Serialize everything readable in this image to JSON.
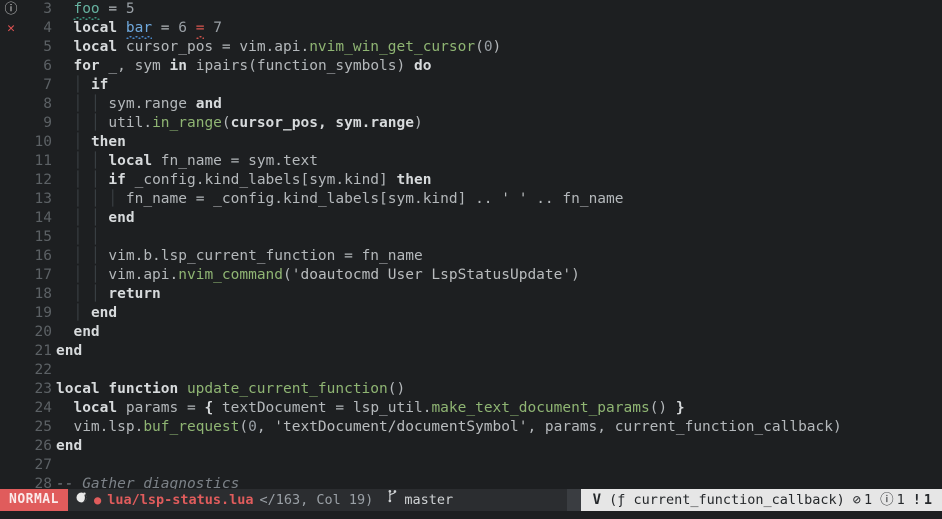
{
  "editor": {
    "lines": [
      {
        "num": "3",
        "sign": "info-icon",
        "tokens": [
          {
            "t": "  ",
            "c": "plain"
          },
          {
            "t": "foo",
            "c": "teal",
            "squiggle": "teal"
          },
          {
            "t": " ",
            "c": "plain"
          },
          {
            "t": "=",
            "c": "op"
          },
          {
            "t": " ",
            "c": "plain"
          },
          {
            "t": "5",
            "c": "num"
          }
        ]
      },
      {
        "num": "4",
        "sign": "error-icon",
        "tokens": [
          {
            "t": "  ",
            "c": "plain"
          },
          {
            "t": "local",
            "c": "kw"
          },
          {
            "t": " ",
            "c": "plain"
          },
          {
            "t": "bar",
            "c": "blue",
            "squiggle": "blue"
          },
          {
            "t": " ",
            "c": "plain"
          },
          {
            "t": "=",
            "c": "op"
          },
          {
            "t": " ",
            "c": "plain"
          },
          {
            "t": "6",
            "c": "num"
          },
          {
            "t": " ",
            "c": "plain"
          },
          {
            "t": "=",
            "c": "red",
            "squiggle": "red"
          },
          {
            "t": " ",
            "c": "plain"
          },
          {
            "t": "7",
            "c": "num"
          }
        ]
      },
      {
        "num": "5",
        "sign": "",
        "tokens": [
          {
            "t": "  ",
            "c": "plain"
          },
          {
            "t": "local",
            "c": "kw"
          },
          {
            "t": " cursor_pos ",
            "c": "ident"
          },
          {
            "t": "=",
            "c": "op"
          },
          {
            "t": " vim.api.",
            "c": "ident"
          },
          {
            "t": "nvim_win_get_cursor",
            "c": "fn"
          },
          {
            "t": "(",
            "c": "op"
          },
          {
            "t": "0",
            "c": "num"
          },
          {
            "t": ")",
            "c": "op"
          }
        ]
      },
      {
        "num": "6",
        "sign": "",
        "tokens": [
          {
            "t": "  ",
            "c": "plain"
          },
          {
            "t": "for",
            "c": "kw"
          },
          {
            "t": " _, sym ",
            "c": "ident"
          },
          {
            "t": "in",
            "c": "kw"
          },
          {
            "t": " ",
            "c": "plain"
          },
          {
            "t": "ipairs",
            "c": "ident"
          },
          {
            "t": "(function_symbols) ",
            "c": "ident"
          },
          {
            "t": "do",
            "c": "kw"
          }
        ]
      },
      {
        "num": "7",
        "sign": "",
        "tokens": [
          {
            "t": "  ",
            "c": "plain"
          },
          {
            "t": "│ ",
            "c": "ig"
          },
          {
            "t": "if",
            "c": "kw"
          }
        ]
      },
      {
        "num": "8",
        "sign": "",
        "tokens": [
          {
            "t": "  ",
            "c": "plain"
          },
          {
            "t": "│ ",
            "c": "ig"
          },
          {
            "t": "│ ",
            "c": "ig"
          },
          {
            "t": "sym.range ",
            "c": "ident"
          },
          {
            "t": "and",
            "c": "kw"
          }
        ]
      },
      {
        "num": "9",
        "sign": "",
        "tokens": [
          {
            "t": "  ",
            "c": "plain"
          },
          {
            "t": "│ ",
            "c": "ig"
          },
          {
            "t": "│ ",
            "c": "ig"
          },
          {
            "t": "util.",
            "c": "ident"
          },
          {
            "t": "in_range",
            "c": "fn"
          },
          {
            "t": "(",
            "c": "op"
          },
          {
            "t": "cursor_pos, sym.range",
            "c": "kw"
          },
          {
            "t": ")",
            "c": "op"
          }
        ]
      },
      {
        "num": "10",
        "sign": "",
        "tokens": [
          {
            "t": "  ",
            "c": "plain"
          },
          {
            "t": "│ ",
            "c": "ig"
          },
          {
            "t": "then",
            "c": "kw"
          }
        ]
      },
      {
        "num": "11",
        "sign": "",
        "tokens": [
          {
            "t": "  ",
            "c": "plain"
          },
          {
            "t": "│ ",
            "c": "ig"
          },
          {
            "t": "│ ",
            "c": "ig"
          },
          {
            "t": "local",
            "c": "kw"
          },
          {
            "t": " fn_name ",
            "c": "ident"
          },
          {
            "t": "=",
            "c": "op"
          },
          {
            "t": " sym.text",
            "c": "ident"
          }
        ]
      },
      {
        "num": "12",
        "sign": "",
        "tokens": [
          {
            "t": "  ",
            "c": "plain"
          },
          {
            "t": "│ ",
            "c": "ig"
          },
          {
            "t": "│ ",
            "c": "ig"
          },
          {
            "t": "if",
            "c": "kw"
          },
          {
            "t": " _config.kind_labels[sym.kind] ",
            "c": "ident"
          },
          {
            "t": "then",
            "c": "kw"
          }
        ]
      },
      {
        "num": "13",
        "sign": "",
        "tokens": [
          {
            "t": "  ",
            "c": "plain"
          },
          {
            "t": "│ ",
            "c": "ig"
          },
          {
            "t": "│ ",
            "c": "ig"
          },
          {
            "t": "│ ",
            "c": "ig"
          },
          {
            "t": "fn_name ",
            "c": "ident"
          },
          {
            "t": "=",
            "c": "op"
          },
          {
            "t": " _config.kind_labels[sym.kind] .. ",
            "c": "ident"
          },
          {
            "t": "' '",
            "c": "str"
          },
          {
            "t": " .. fn_name",
            "c": "ident"
          }
        ]
      },
      {
        "num": "14",
        "sign": "",
        "tokens": [
          {
            "t": "  ",
            "c": "plain"
          },
          {
            "t": "│ ",
            "c": "ig"
          },
          {
            "t": "│ ",
            "c": "ig"
          },
          {
            "t": "end",
            "c": "kw"
          }
        ]
      },
      {
        "num": "15",
        "sign": "",
        "tokens": [
          {
            "t": "  ",
            "c": "plain"
          },
          {
            "t": "│ ",
            "c": "ig"
          },
          {
            "t": "│",
            "c": "ig"
          }
        ]
      },
      {
        "num": "16",
        "sign": "",
        "tokens": [
          {
            "t": "  ",
            "c": "plain"
          },
          {
            "t": "│ ",
            "c": "ig"
          },
          {
            "t": "│ ",
            "c": "ig"
          },
          {
            "t": "vim.b.lsp_current_function ",
            "c": "ident"
          },
          {
            "t": "=",
            "c": "op"
          },
          {
            "t": " fn_name",
            "c": "ident"
          }
        ]
      },
      {
        "num": "17",
        "sign": "",
        "tokens": [
          {
            "t": "  ",
            "c": "plain"
          },
          {
            "t": "│ ",
            "c": "ig"
          },
          {
            "t": "│ ",
            "c": "ig"
          },
          {
            "t": "vim.api.",
            "c": "ident"
          },
          {
            "t": "nvim_command",
            "c": "fn"
          },
          {
            "t": "(",
            "c": "op"
          },
          {
            "t": "'doautocmd User LspStatusUpdate'",
            "c": "str"
          },
          {
            "t": ")",
            "c": "op"
          }
        ]
      },
      {
        "num": "18",
        "sign": "",
        "tokens": [
          {
            "t": "  ",
            "c": "plain"
          },
          {
            "t": "│ ",
            "c": "ig"
          },
          {
            "t": "│ ",
            "c": "ig"
          },
          {
            "t": "return",
            "c": "kw"
          }
        ]
      },
      {
        "num": "19",
        "sign": "",
        "tokens": [
          {
            "t": "  ",
            "c": "plain"
          },
          {
            "t": "│ ",
            "c": "ig"
          },
          {
            "t": "end",
            "c": "kw"
          }
        ]
      },
      {
        "num": "20",
        "sign": "",
        "tokens": [
          {
            "t": "  ",
            "c": "plain"
          },
          {
            "t": "end",
            "c": "kw"
          }
        ]
      },
      {
        "num": "21",
        "sign": "",
        "tokens": [
          {
            "t": "end",
            "c": "kw"
          }
        ]
      },
      {
        "num": "22",
        "sign": "",
        "tokens": []
      },
      {
        "num": "23",
        "sign": "",
        "tokens": [
          {
            "t": "local function",
            "c": "kw"
          },
          {
            "t": " ",
            "c": "plain"
          },
          {
            "t": "update_current_function",
            "c": "fn"
          },
          {
            "t": "()",
            "c": "op"
          }
        ]
      },
      {
        "num": "24",
        "sign": "",
        "tokens": [
          {
            "t": "  ",
            "c": "plain"
          },
          {
            "t": "local",
            "c": "kw"
          },
          {
            "t": " params ",
            "c": "ident"
          },
          {
            "t": "=",
            "c": "op"
          },
          {
            "t": " ",
            "c": "plain"
          },
          {
            "t": "{",
            "c": "brace"
          },
          {
            "t": " textDocument ",
            "c": "ident"
          },
          {
            "t": "=",
            "c": "op"
          },
          {
            "t": " lsp_util.",
            "c": "ident"
          },
          {
            "t": "make_text_document_params",
            "c": "fn"
          },
          {
            "t": "() ",
            "c": "op"
          },
          {
            "t": "}",
            "c": "brace"
          }
        ]
      },
      {
        "num": "25",
        "sign": "",
        "tokens": [
          {
            "t": "  ",
            "c": "plain"
          },
          {
            "t": "vim.lsp.",
            "c": "ident"
          },
          {
            "t": "buf_request",
            "c": "fn"
          },
          {
            "t": "(",
            "c": "op"
          },
          {
            "t": "0",
            "c": "num"
          },
          {
            "t": ", ",
            "c": "op"
          },
          {
            "t": "'textDocument/documentSymbol'",
            "c": "str"
          },
          {
            "t": ", params, current_function_callback",
            "c": "ident"
          },
          {
            "t": ")",
            "c": "op"
          }
        ]
      },
      {
        "num": "26",
        "sign": "",
        "tokens": [
          {
            "t": "end",
            "c": "kw"
          }
        ]
      },
      {
        "num": "27",
        "sign": "",
        "tokens": []
      },
      {
        "num": "28",
        "sign": "",
        "tokens": [
          {
            "t": "-- Gather diagnostics",
            "c": "cmt"
          }
        ]
      }
    ]
  },
  "statusline": {
    "mode": "NORMAL",
    "modified_icon": "modified-circle-icon",
    "unsaved_dot": "●",
    "filename": "lua/lsp-status.lua",
    "position": "</163, Col 19)",
    "branch_icon": "git-branch-icon",
    "branch": "master",
    "visual_marker": "V",
    "context": "(ƒ current_function_callback)",
    "diagnostics": [
      {
        "icon": "error-icon",
        "glyph": "⊘",
        "count": "1"
      },
      {
        "icon": "info-icon",
        "glyph": "ⓘ",
        "count": "1"
      },
      {
        "icon": "warning-icon",
        "glyph": "!",
        "count": "1"
      }
    ]
  },
  "cmdline": {
    "text": ""
  },
  "colors": {
    "background": "#1d1f21",
    "mode_accent": "#e05c5c",
    "filename_accent": "#e05c5c",
    "statusline_bg": "#2b2d30",
    "statusline_right_bg": "#e6e6e6",
    "error": "#d8564f",
    "function": "#8fb573",
    "teal": "#66b2a0",
    "blue": "#6fa8dc"
  }
}
